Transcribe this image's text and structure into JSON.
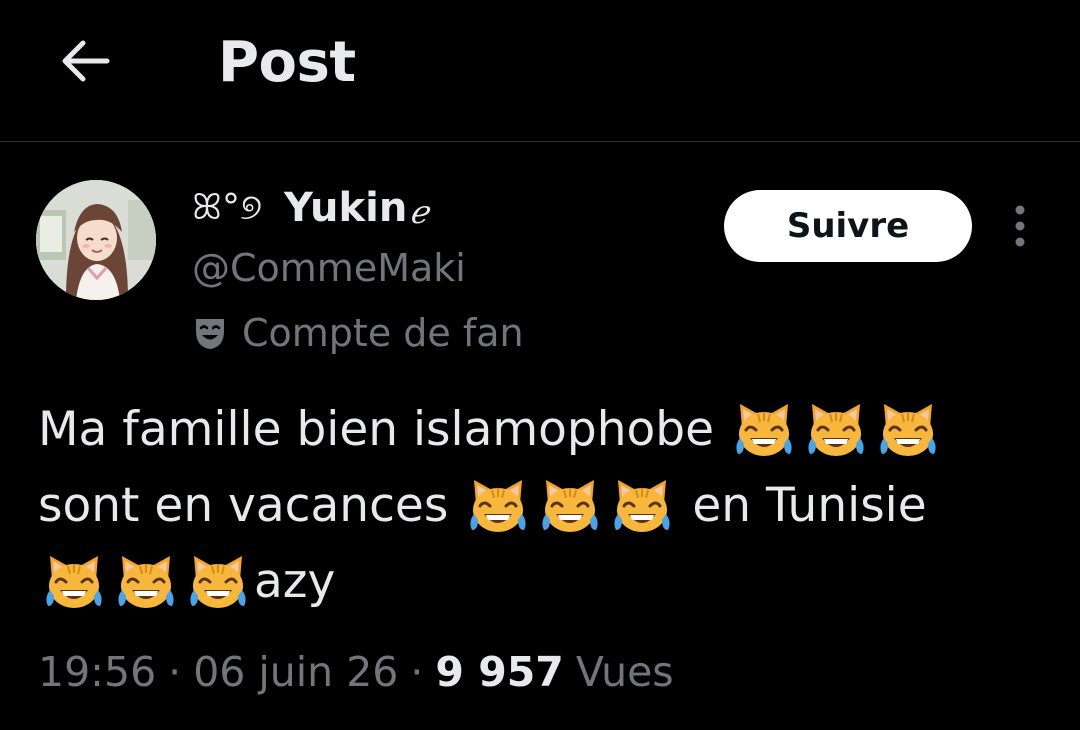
{
  "header": {
    "title": "Post",
    "back_icon": "arrow-left-icon"
  },
  "author": {
    "name_deco": "ꕤ°୭",
    "name": "Yukin",
    "name_suffix": "ℯ",
    "handle": "@CommeMaki",
    "fan_label": "Compte de fan",
    "fan_icon": "theater-mask-icon",
    "avatar_icon": "avatar-anime-girl"
  },
  "actions": {
    "follow_label": "Suivre",
    "more_icon": "more-vertical-icon"
  },
  "post": {
    "line1_text": "Ma famille bien islamophobe",
    "line2_text_a": "sont en vacances",
    "line2_text_b": "en Tunisie",
    "line3_text": "azy",
    "emoji_name": "cat-face-with-tears-of-joy-emoji"
  },
  "meta": {
    "time": "19:56",
    "separator": "·",
    "date": "06 juin 26",
    "views_count": "9 957",
    "views_label": "Vues"
  },
  "colors": {
    "background": "#000000",
    "primary_text": "#e7e9ea",
    "secondary_text": "#71767b",
    "divider": "#2f3336",
    "follow_bg": "#ffffff"
  }
}
